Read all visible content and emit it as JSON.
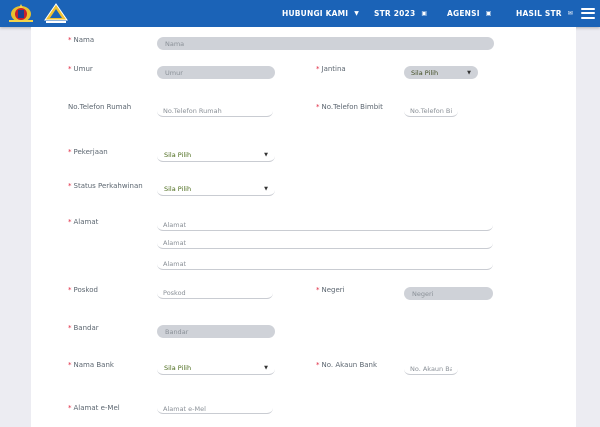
{
  "nav": {
    "items": [
      {
        "label": "HUBUNGI KAMI",
        "icon": "caret-down-icon"
      },
      {
        "label": "STR 2023",
        "icon": "folder-icon"
      },
      {
        "label": "AGENSI",
        "icon": "folder-icon"
      },
      {
        "label": "HASIL STR",
        "icon": "envelope-icon"
      }
    ]
  },
  "form": {
    "nama": {
      "label": "Nama",
      "placeholder": "Nama"
    },
    "umur": {
      "label": "Umur",
      "placeholder": "Umur"
    },
    "jantina": {
      "label": "Jantina",
      "value": "Sila Pilih"
    },
    "telefon_rumah": {
      "label": "No.Telefon Rumah",
      "placeholder": "No.Telefon Rumah"
    },
    "telefon_bimbit": {
      "label": "No.Telefon Bimbit",
      "placeholder": "No.Telefon Bimbit"
    },
    "pekerjaan": {
      "label": "Pekerjaan",
      "value": "Sila Pilih"
    },
    "status_perkahwinan": {
      "label": "Status Perkahwinan",
      "value": "Sila Pilih"
    },
    "alamat": {
      "label": "Alamat",
      "placeholders": [
        "Alamat",
        "Alamat",
        "Alamat"
      ]
    },
    "poskod": {
      "label": "Poskod",
      "placeholder": "Poskod"
    },
    "negeri": {
      "label": "Negeri",
      "placeholder": "Negeri"
    },
    "bandar": {
      "label": "Bandar",
      "placeholder": "Bandar"
    },
    "nama_bank": {
      "label": "Nama Bank",
      "value": "Sila Pilih"
    },
    "akaun_bank": {
      "label": "No. Akaun Bank",
      "placeholder": "No. Akaun Bank"
    },
    "email": {
      "label": "Alamat e-Mel",
      "placeholder": "Alamat e-Mel"
    }
  },
  "required_mark": "*",
  "colors": {
    "topbar": "#1b63b7",
    "required": "#e0263f",
    "background": "#ececf2"
  }
}
